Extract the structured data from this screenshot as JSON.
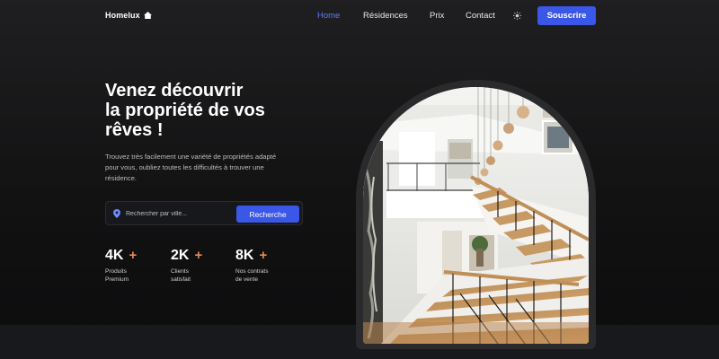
{
  "header": {
    "logo_text": "Homelux",
    "logo_icon": "home-icon",
    "nav": [
      {
        "label": "Home",
        "active": true
      },
      {
        "label": "Résidences",
        "active": false
      },
      {
        "label": "Prix",
        "active": false
      },
      {
        "label": "Contact",
        "active": false
      }
    ],
    "theme_icon": "sun-icon",
    "subscribe_label": "Souscrire"
  },
  "hero": {
    "title_lines": [
      "Venez découvrir",
      "la propriété de vos",
      "rêves !"
    ],
    "description_lines": [
      "Trouvez très facilement une variété de propriétés adapté",
      "pour vous, oubliez toutes les difficultés à trouver une",
      "résidence."
    ]
  },
  "search": {
    "icon": "map-pin-icon",
    "placeholder": "Rechercher par ville...",
    "value": "",
    "button_label": "Recherche"
  },
  "stats": [
    {
      "value": "4K",
      "plus": "+",
      "label_lines": [
        "Produits",
        "Premium"
      ]
    },
    {
      "value": "2K",
      "plus": "+",
      "label_lines": [
        "Clients",
        "satisfait"
      ]
    },
    {
      "value": "8K",
      "plus": "+",
      "label_lines": [
        "Nos contrats",
        "de vente"
      ]
    }
  ],
  "colors": {
    "accent": "#3b57e8",
    "active_nav": "#5b7bff",
    "plus_color": "#e8895a",
    "background": "#121213"
  }
}
